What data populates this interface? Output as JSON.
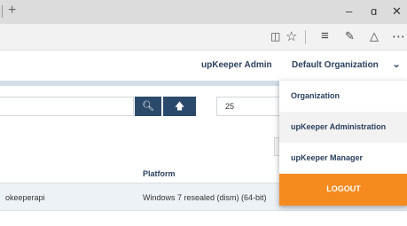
{
  "browser": {
    "new_tab": "+",
    "minimize": "–",
    "restore": "ɑ",
    "close": "✕",
    "icons": [
      "reading-view-icon",
      "favorite-star-icon",
      "hub-icon",
      "web-note-icon",
      "share-icon",
      "more-icon"
    ]
  },
  "header": {
    "user": "upKeeper Admin",
    "organization": "Default Organization"
  },
  "search": {
    "value": "",
    "page_size": "25"
  },
  "table": {
    "columns": [
      "Platform"
    ],
    "rows": [
      {
        "name": "okeeperapi",
        "platform": "Windows 7 resealed (dism) (64-bit)"
      }
    ]
  },
  "menu": {
    "items": [
      "Organization",
      "upKeeper Administration",
      "upKeeper Manager"
    ],
    "logout": "LOGOUT"
  },
  "colors": {
    "navy": "#2b4a6b",
    "logout": "#f58a1f"
  }
}
